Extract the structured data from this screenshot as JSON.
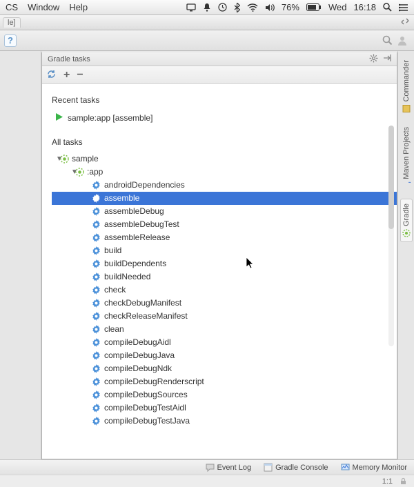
{
  "menubar": {
    "items": [
      "CS",
      "Window",
      "Help"
    ],
    "battery_pct": "76%",
    "day": "Wed",
    "time": "16:18"
  },
  "tabstrip": {
    "label": "le]"
  },
  "toolbar": {
    "help_label": "?"
  },
  "panel": {
    "title": "Gradle tasks",
    "recent_label": "Recent tasks",
    "recent_item": "sample:app [assemble]",
    "all_label": "All tasks",
    "root_module": "sample",
    "sub_module": ":app",
    "selected_task": "assemble",
    "tasks": [
      "androidDependencies",
      "assemble",
      "assembleDebug",
      "assembleDebugTest",
      "assembleRelease",
      "build",
      "buildDependents",
      "buildNeeded",
      "check",
      "checkDebugManifest",
      "checkReleaseManifest",
      "clean",
      "compileDebugAidl",
      "compileDebugJava",
      "compileDebugNdk",
      "compileDebugRenderscript",
      "compileDebugSources",
      "compileDebugTestAidl",
      "compileDebugTestJava"
    ]
  },
  "rightdock": {
    "items": [
      "Commander",
      "Maven Projects",
      "Gradle"
    ],
    "active": "Gradle"
  },
  "statusbar": {
    "event_log": "Event Log",
    "gradle_console": "Gradle Console",
    "memory_monitor": "Memory Monitor",
    "pos": "1:1"
  }
}
